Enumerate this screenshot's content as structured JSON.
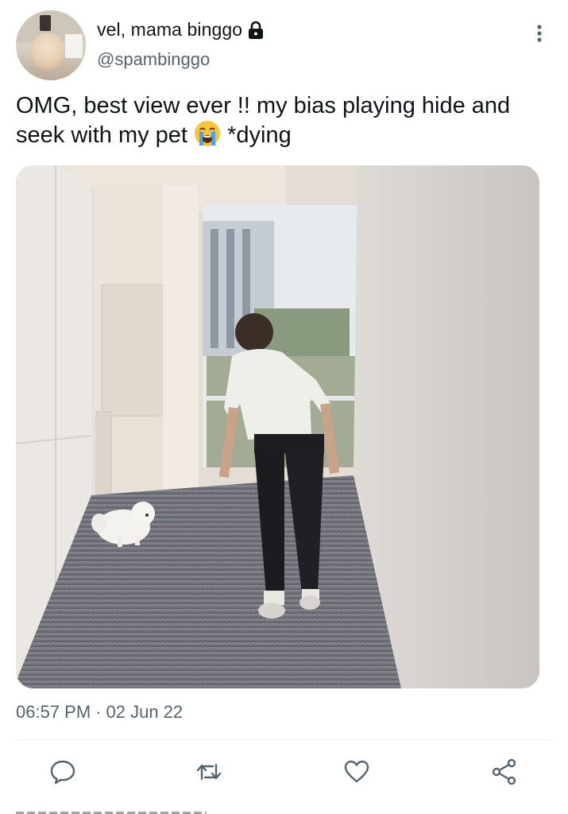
{
  "author": {
    "display_name": "vel, mama binggo",
    "username": "@spambinggo",
    "protected_icon": "lock-icon",
    "avatar_icon": "avatar"
  },
  "tweet": {
    "text_before_emoji": "OMG, best view ever !! my bias playing hide and seek with my pet",
    "emoji": "loudly-crying-face-emoji",
    "text_after_emoji": " *dying"
  },
  "meta": {
    "time": "06:57 PM",
    "separator": "·",
    "date": "02 Jun 22"
  },
  "actions": {
    "reply_icon": "reply-icon",
    "retweet_icon": "retweet-icon",
    "like_icon": "heart-icon",
    "share_icon": "share-icon"
  },
  "colors": {
    "text_primary": "#0f1419",
    "text_secondary": "#536471",
    "divider": "#eff3f4"
  }
}
